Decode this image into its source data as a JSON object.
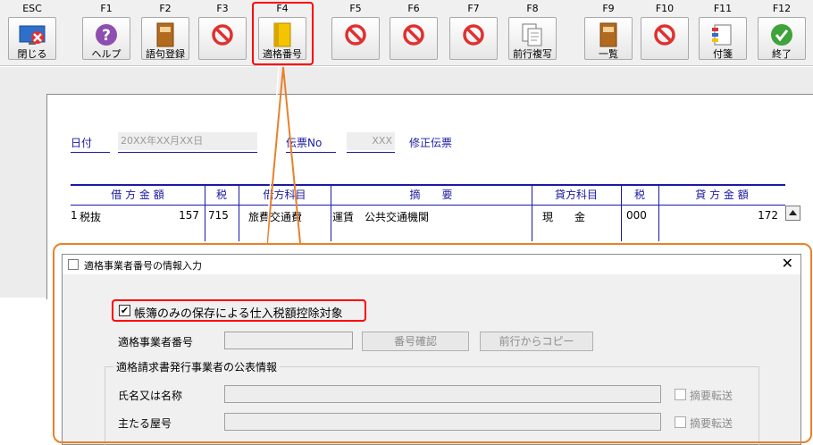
{
  "toolbar": {
    "buttons": [
      {
        "key": "ESC",
        "label": "閉じる",
        "icon": "close-window-icon"
      },
      {
        "key": "F1",
        "label": "ヘルプ",
        "icon": "help-icon"
      },
      {
        "key": "F2",
        "label": "語句登録",
        "icon": "book-icon"
      },
      {
        "key": "F3",
        "label": "",
        "icon": "disabled-icon"
      },
      {
        "key": "F4",
        "label": "適格番号",
        "icon": "yellow-book-icon"
      },
      {
        "key": "F5",
        "label": "",
        "icon": "disabled-icon"
      },
      {
        "key": "F6",
        "label": "",
        "icon": "disabled-icon"
      },
      {
        "key": "F7",
        "label": "",
        "icon": "disabled-icon"
      },
      {
        "key": "F8",
        "label": "前行複写",
        "icon": "copy-icon"
      },
      {
        "key": "F9",
        "label": "一覧",
        "icon": "book-icon"
      },
      {
        "key": "F10",
        "label": "",
        "icon": "disabled-icon"
      },
      {
        "key": "F11",
        "label": "付箋",
        "icon": "sticky-note-icon"
      },
      {
        "key": "F12",
        "label": "終了",
        "icon": "check-icon"
      }
    ]
  },
  "voucher": {
    "date_label": "日付",
    "date_value": "20XX年XX月XX日",
    "denpyo_label": "伝票No",
    "denpyo_value": "XXX",
    "shusei_label": "修正伝票"
  },
  "journal": {
    "headers": [
      "借 方 金 額",
      "税",
      "借方科目",
      "摘　　要",
      "貸方科目",
      "税",
      "貸 方 金 額"
    ],
    "row": {
      "no": "1",
      "tax_type": "税抜",
      "debit_amount": "157",
      "debit_tax": "715",
      "debit_account": "旅費交通費",
      "description": "運賃　公共交通機関",
      "credit_account": "現　　金",
      "credit_tax": "000",
      "credit_amount": "172"
    }
  },
  "dialog": {
    "title": "適格事業者番号の情報入力",
    "checkbox_label": "帳簿のみの保存による仕入税額控除対象",
    "checkbox_checked": "✔",
    "registration_label": "適格事業者番号",
    "confirm_button": "番号確認",
    "copy_button": "前行からコピー",
    "group_title": "適格請求書発行事業者の公表情報",
    "name_label": "氏名又は名称",
    "trade_name_label": "主たる屋号",
    "transfer_label": "摘要転送"
  },
  "colors": {
    "accent_blue": "#1a1aa6",
    "highlight_red": "#ff0000",
    "callout_orange": "#e8812a"
  }
}
